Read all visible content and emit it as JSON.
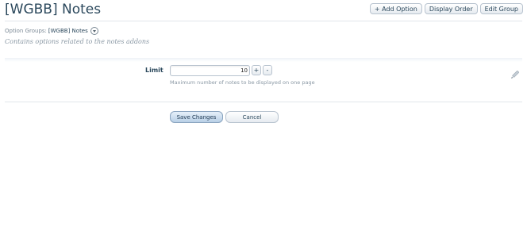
{
  "page": {
    "title": "[WGBB] Notes"
  },
  "top_actions": {
    "add_option": "+ Add Option",
    "display_order": "Display Order",
    "edit_group": "Edit Group"
  },
  "option_groups": {
    "label": "Option Groups:",
    "value": "[WGBB] Notes"
  },
  "group_description": "Contains options related to the notes addons",
  "options": [
    {
      "label": "Limit",
      "value": "10",
      "hint": "Maximum number of notes to be displayed on one page",
      "increment": "+",
      "decrement": "-"
    }
  ],
  "form_buttons": {
    "save": "Save Changes",
    "cancel": "Cancel"
  },
  "icons": {
    "option_groups_toggle": "chevron-down-circle-icon",
    "option_edit": "pencil-icon"
  },
  "colors": {
    "title": "#2b485c",
    "muted": "#8a98a4",
    "primary_button": "#b8cfe6"
  }
}
